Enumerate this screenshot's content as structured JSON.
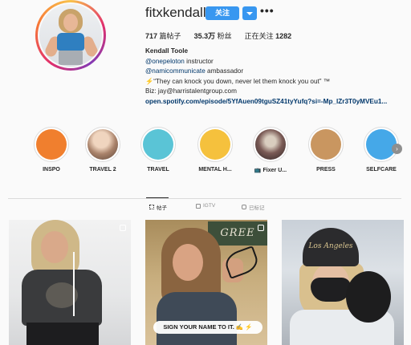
{
  "profile": {
    "username": "fitxkendall",
    "follow_label": "关注",
    "more_label": "•••",
    "stats": {
      "posts_count": "717",
      "posts_label": "篇帖子",
      "followers_count": "35.3万",
      "followers_label": "粉丝",
      "following_label": "正在关注",
      "following_count": "1282"
    },
    "bio": {
      "name": "Kendall Toole",
      "line1_mention": "@onepeloton",
      "line1_text": " instructor",
      "line2_mention": "@namicommunicate",
      "line2_text": " ambassador",
      "line3": "⚡“They can knock you down, never let them knock you out” ™",
      "line4": "Biz: jay@harristalentgroup.com",
      "link": "open.spotify.com/episode/5YfAuen09tguSZ41tyYufq?si=-Mp_lZr3T0yMVEu1..."
    }
  },
  "stories": [
    {
      "label": "INSPO",
      "color": "#f07f2e"
    },
    {
      "label": "TRAVEL 2",
      "color": "#d9b8a0"
    },
    {
      "label": "TRAVEL",
      "color": "#5ac4d6"
    },
    {
      "label": "MENTAL H...",
      "color": "#f5c13d"
    },
    {
      "label": "📺 Fixer U...",
      "color": "#8a6b66"
    },
    {
      "label": "PRESS",
      "color": "#c99660"
    },
    {
      "label": "SELFCARE",
      "color": "#45a8e8"
    }
  ],
  "stories_next": "›",
  "tabs": {
    "posts": "帖子",
    "igtv": "IGTV",
    "tagged": "已标记"
  },
  "posts": {
    "post2_sign": "GREE",
    "post2_banner": "SIGN YOUR NAME TO IT. ✍ ⚡",
    "post3_beanie": "Los Angeles"
  },
  "colors": {
    "accent": "#3897f0",
    "link": "#00376b"
  }
}
